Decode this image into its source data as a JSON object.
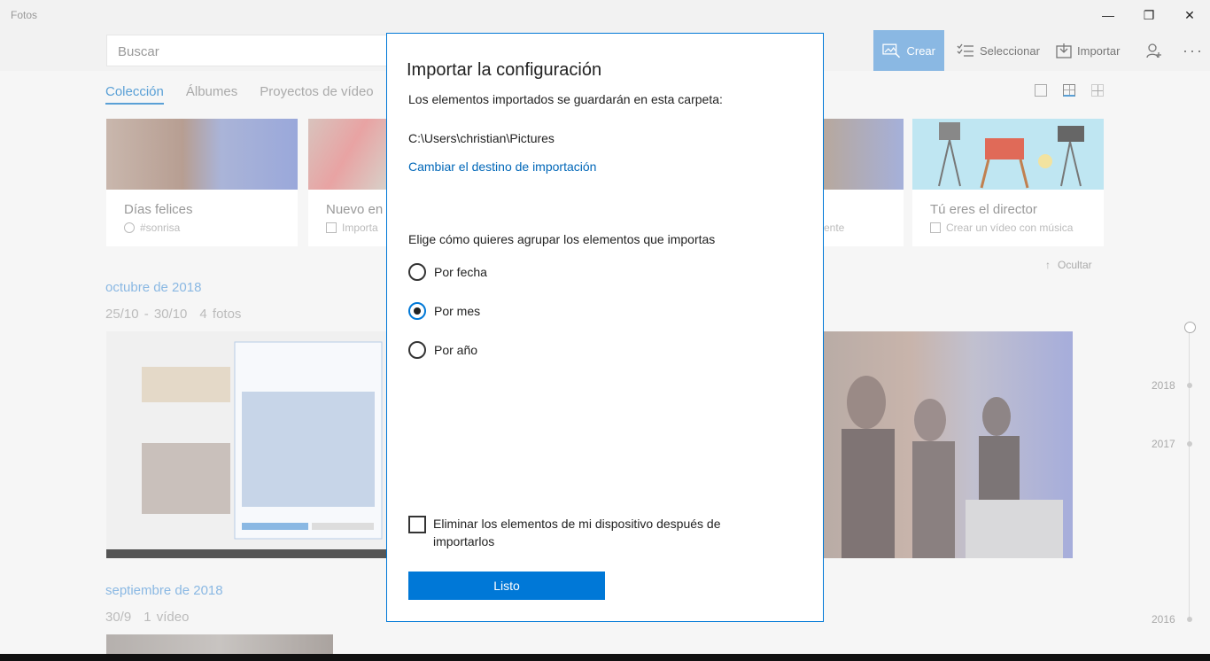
{
  "window": {
    "title": "Fotos",
    "minimize": "—",
    "maximize": "❐",
    "close": "✕"
  },
  "toolbar": {
    "search_placeholder": "Buscar",
    "create": "Crear",
    "select": "Seleccionar",
    "import": "Importar",
    "more": "···"
  },
  "tabs": [
    "Colección",
    "Álbumes",
    "Proyectos de vídeo"
  ],
  "cards": [
    {
      "title": "Días felices",
      "subtitle": "#sonrisa"
    },
    {
      "title": "Nuevo en",
      "subtitle": "Importa"
    },
    {
      "title": "",
      "subtitle": "ente"
    },
    {
      "title": "Tú eres el director",
      "subtitle": "Crear un vídeo con música"
    }
  ],
  "hide": "Ocultar",
  "sections": [
    {
      "month": "octubre de 2018",
      "range": "25/10 - 30/10",
      "count": "4 fotos"
    },
    {
      "month": "septiembre de 2018",
      "range": "30/9",
      "count": "1 vídeo"
    }
  ],
  "timeline": {
    "years": [
      "2018",
      "2017",
      "2016"
    ]
  },
  "dialog": {
    "title": "Importar la configuración",
    "folder_intro": "Los elementos importados se guardarán en esta carpeta:",
    "folder_path": "C:\\Users\\christian\\Pictures",
    "change_link": "Cambiar el destino de importación",
    "group_prompt": "Elige cómo quieres agrupar los elementos que importas",
    "options": [
      {
        "label": "Por fecha",
        "checked": false
      },
      {
        "label": "Por mes",
        "checked": true
      },
      {
        "label": "Por año",
        "checked": false
      }
    ],
    "delete_checkbox": "Eliminar los elementos de mi dispositivo después de importarlos",
    "done": "Listo"
  }
}
